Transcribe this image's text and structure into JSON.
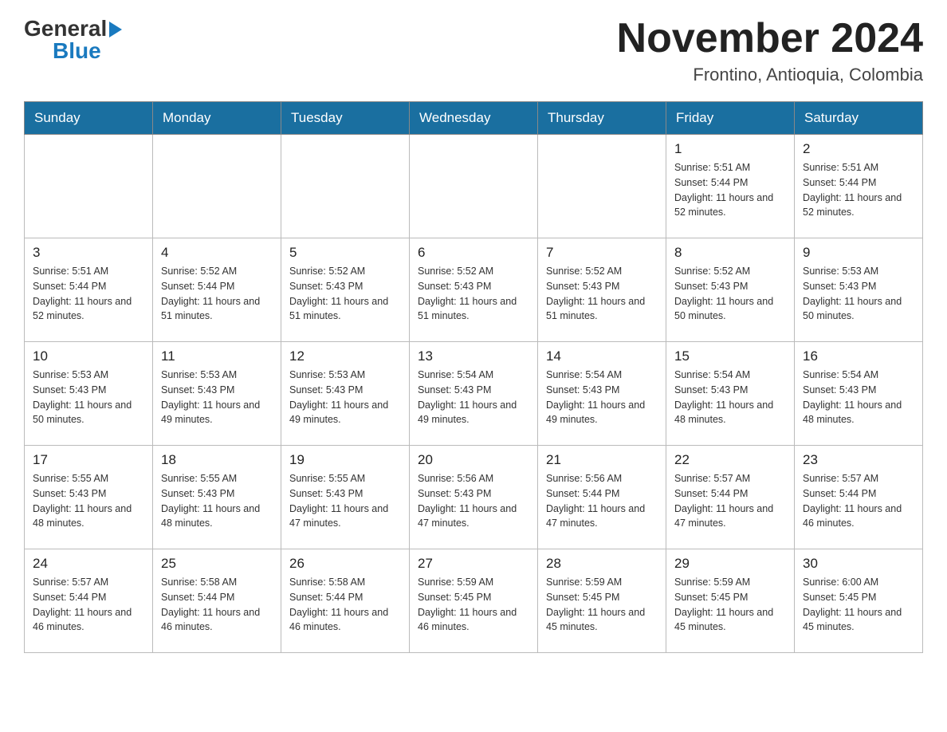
{
  "header": {
    "logo_general": "General",
    "logo_blue": "Blue",
    "month_title": "November 2024",
    "location": "Frontino, Antioquia, Colombia"
  },
  "weekdays": [
    "Sunday",
    "Monday",
    "Tuesday",
    "Wednesday",
    "Thursday",
    "Friday",
    "Saturday"
  ],
  "weeks": [
    [
      {
        "day": "",
        "sunrise": "",
        "sunset": "",
        "daylight": ""
      },
      {
        "day": "",
        "sunrise": "",
        "sunset": "",
        "daylight": ""
      },
      {
        "day": "",
        "sunrise": "",
        "sunset": "",
        "daylight": ""
      },
      {
        "day": "",
        "sunrise": "",
        "sunset": "",
        "daylight": ""
      },
      {
        "day": "",
        "sunrise": "",
        "sunset": "",
        "daylight": ""
      },
      {
        "day": "1",
        "sunrise": "Sunrise: 5:51 AM",
        "sunset": "Sunset: 5:44 PM",
        "daylight": "Daylight: 11 hours and 52 minutes."
      },
      {
        "day": "2",
        "sunrise": "Sunrise: 5:51 AM",
        "sunset": "Sunset: 5:44 PM",
        "daylight": "Daylight: 11 hours and 52 minutes."
      }
    ],
    [
      {
        "day": "3",
        "sunrise": "Sunrise: 5:51 AM",
        "sunset": "Sunset: 5:44 PM",
        "daylight": "Daylight: 11 hours and 52 minutes."
      },
      {
        "day": "4",
        "sunrise": "Sunrise: 5:52 AM",
        "sunset": "Sunset: 5:44 PM",
        "daylight": "Daylight: 11 hours and 51 minutes."
      },
      {
        "day": "5",
        "sunrise": "Sunrise: 5:52 AM",
        "sunset": "Sunset: 5:43 PM",
        "daylight": "Daylight: 11 hours and 51 minutes."
      },
      {
        "day": "6",
        "sunrise": "Sunrise: 5:52 AM",
        "sunset": "Sunset: 5:43 PM",
        "daylight": "Daylight: 11 hours and 51 minutes."
      },
      {
        "day": "7",
        "sunrise": "Sunrise: 5:52 AM",
        "sunset": "Sunset: 5:43 PM",
        "daylight": "Daylight: 11 hours and 51 minutes."
      },
      {
        "day": "8",
        "sunrise": "Sunrise: 5:52 AM",
        "sunset": "Sunset: 5:43 PM",
        "daylight": "Daylight: 11 hours and 50 minutes."
      },
      {
        "day": "9",
        "sunrise": "Sunrise: 5:53 AM",
        "sunset": "Sunset: 5:43 PM",
        "daylight": "Daylight: 11 hours and 50 minutes."
      }
    ],
    [
      {
        "day": "10",
        "sunrise": "Sunrise: 5:53 AM",
        "sunset": "Sunset: 5:43 PM",
        "daylight": "Daylight: 11 hours and 50 minutes."
      },
      {
        "day": "11",
        "sunrise": "Sunrise: 5:53 AM",
        "sunset": "Sunset: 5:43 PM",
        "daylight": "Daylight: 11 hours and 49 minutes."
      },
      {
        "day": "12",
        "sunrise": "Sunrise: 5:53 AM",
        "sunset": "Sunset: 5:43 PM",
        "daylight": "Daylight: 11 hours and 49 minutes."
      },
      {
        "day": "13",
        "sunrise": "Sunrise: 5:54 AM",
        "sunset": "Sunset: 5:43 PM",
        "daylight": "Daylight: 11 hours and 49 minutes."
      },
      {
        "day": "14",
        "sunrise": "Sunrise: 5:54 AM",
        "sunset": "Sunset: 5:43 PM",
        "daylight": "Daylight: 11 hours and 49 minutes."
      },
      {
        "day": "15",
        "sunrise": "Sunrise: 5:54 AM",
        "sunset": "Sunset: 5:43 PM",
        "daylight": "Daylight: 11 hours and 48 minutes."
      },
      {
        "day": "16",
        "sunrise": "Sunrise: 5:54 AM",
        "sunset": "Sunset: 5:43 PM",
        "daylight": "Daylight: 11 hours and 48 minutes."
      }
    ],
    [
      {
        "day": "17",
        "sunrise": "Sunrise: 5:55 AM",
        "sunset": "Sunset: 5:43 PM",
        "daylight": "Daylight: 11 hours and 48 minutes."
      },
      {
        "day": "18",
        "sunrise": "Sunrise: 5:55 AM",
        "sunset": "Sunset: 5:43 PM",
        "daylight": "Daylight: 11 hours and 48 minutes."
      },
      {
        "day": "19",
        "sunrise": "Sunrise: 5:55 AM",
        "sunset": "Sunset: 5:43 PM",
        "daylight": "Daylight: 11 hours and 47 minutes."
      },
      {
        "day": "20",
        "sunrise": "Sunrise: 5:56 AM",
        "sunset": "Sunset: 5:43 PM",
        "daylight": "Daylight: 11 hours and 47 minutes."
      },
      {
        "day": "21",
        "sunrise": "Sunrise: 5:56 AM",
        "sunset": "Sunset: 5:44 PM",
        "daylight": "Daylight: 11 hours and 47 minutes."
      },
      {
        "day": "22",
        "sunrise": "Sunrise: 5:57 AM",
        "sunset": "Sunset: 5:44 PM",
        "daylight": "Daylight: 11 hours and 47 minutes."
      },
      {
        "day": "23",
        "sunrise": "Sunrise: 5:57 AM",
        "sunset": "Sunset: 5:44 PM",
        "daylight": "Daylight: 11 hours and 46 minutes."
      }
    ],
    [
      {
        "day": "24",
        "sunrise": "Sunrise: 5:57 AM",
        "sunset": "Sunset: 5:44 PM",
        "daylight": "Daylight: 11 hours and 46 minutes."
      },
      {
        "day": "25",
        "sunrise": "Sunrise: 5:58 AM",
        "sunset": "Sunset: 5:44 PM",
        "daylight": "Daylight: 11 hours and 46 minutes."
      },
      {
        "day": "26",
        "sunrise": "Sunrise: 5:58 AM",
        "sunset": "Sunset: 5:44 PM",
        "daylight": "Daylight: 11 hours and 46 minutes."
      },
      {
        "day": "27",
        "sunrise": "Sunrise: 5:59 AM",
        "sunset": "Sunset: 5:45 PM",
        "daylight": "Daylight: 11 hours and 46 minutes."
      },
      {
        "day": "28",
        "sunrise": "Sunrise: 5:59 AM",
        "sunset": "Sunset: 5:45 PM",
        "daylight": "Daylight: 11 hours and 45 minutes."
      },
      {
        "day": "29",
        "sunrise": "Sunrise: 5:59 AM",
        "sunset": "Sunset: 5:45 PM",
        "daylight": "Daylight: 11 hours and 45 minutes."
      },
      {
        "day": "30",
        "sunrise": "Sunrise: 6:00 AM",
        "sunset": "Sunset: 5:45 PM",
        "daylight": "Daylight: 11 hours and 45 minutes."
      }
    ]
  ]
}
